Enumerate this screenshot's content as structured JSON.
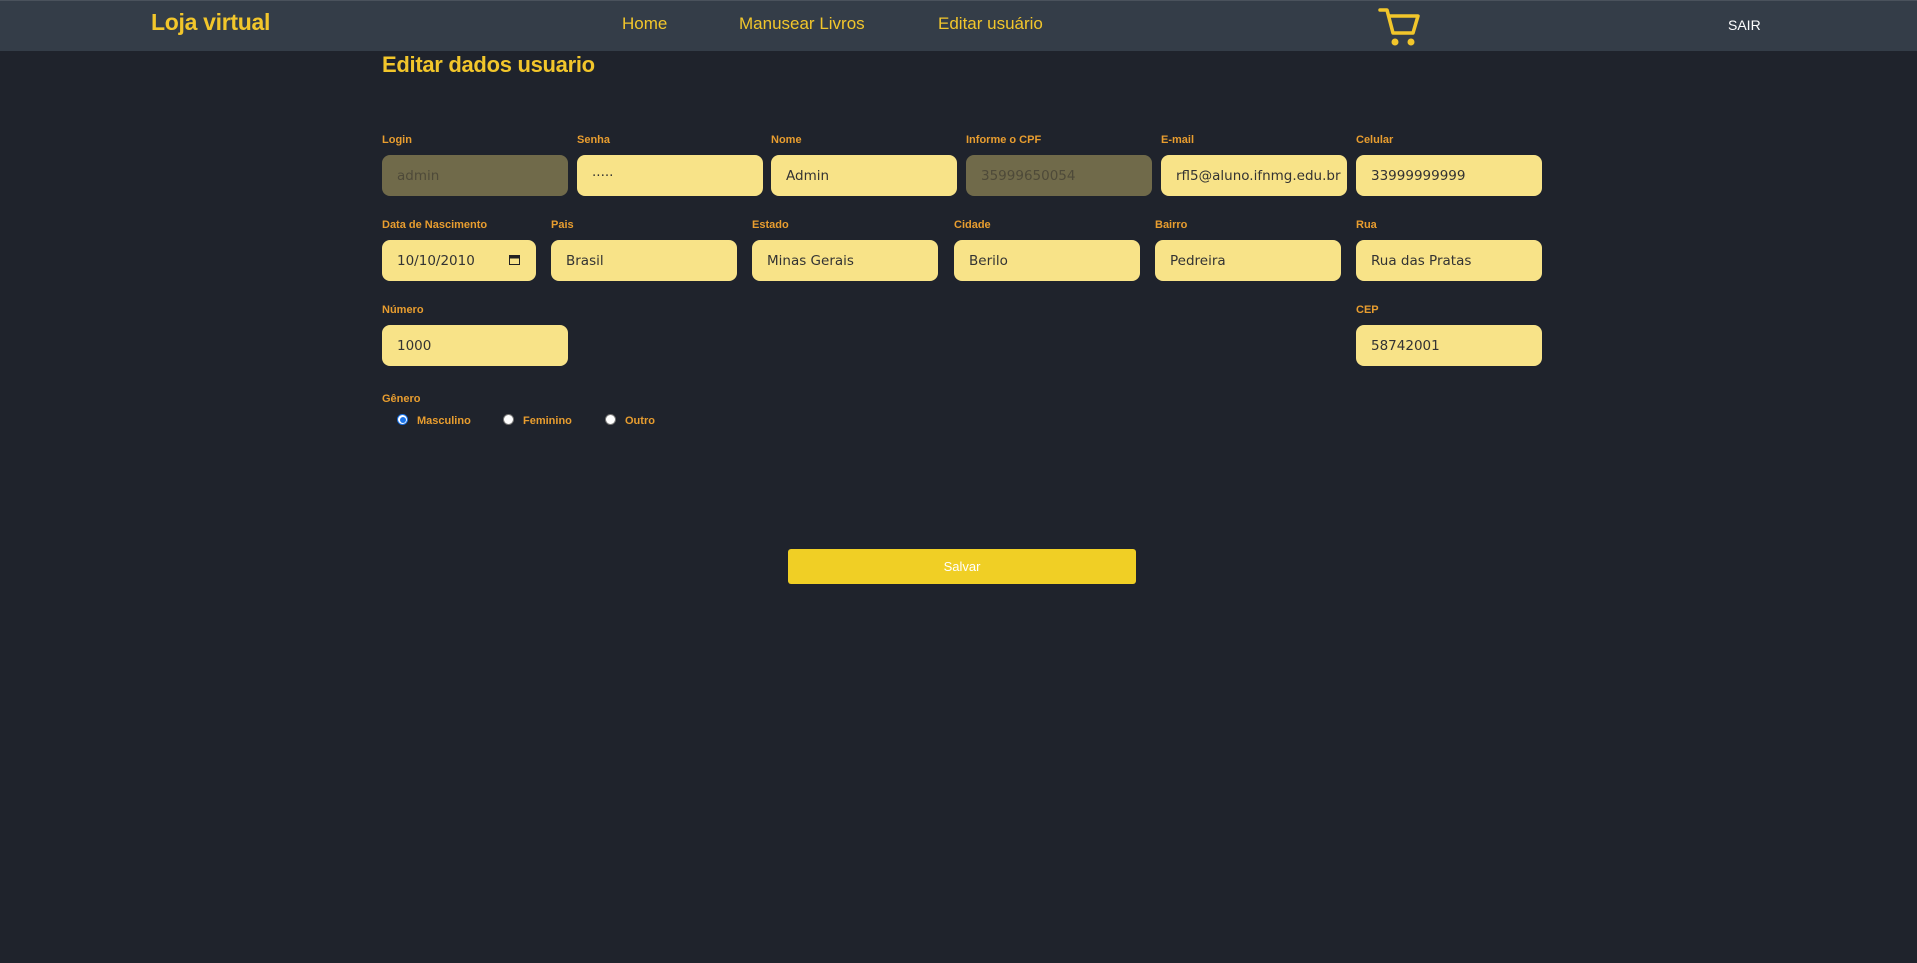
{
  "navbar": {
    "brand": "Loja virtual",
    "links": [
      "Home",
      "Manusear Livros",
      "Editar usuário"
    ],
    "cart_icon": "shopping-cart-icon",
    "logout": "SAIR"
  },
  "page_title": "Editar dados usuario",
  "form": {
    "login": {
      "label": "Login",
      "value": "admin",
      "disabled": true
    },
    "senha": {
      "label": "Senha",
      "value": "·····"
    },
    "nome": {
      "label": "Nome",
      "value": "Admin"
    },
    "cpf": {
      "label": "Informe o CPF",
      "value": "35999650054",
      "disabled": true
    },
    "email": {
      "label": "E-mail",
      "value": "rfl5@aluno.ifnmg.edu.br"
    },
    "celular": {
      "label": "Celular",
      "value": "33999999999"
    },
    "nascimento": {
      "label": "Data de Nascimento",
      "value": "10/10/2010",
      "icon": "calendar-icon"
    },
    "pais": {
      "label": "Pais",
      "value": "Brasil"
    },
    "estado": {
      "label": "Estado",
      "value": "Minas Gerais"
    },
    "cidade": {
      "label": "Cidade",
      "value": "Berilo"
    },
    "bairro": {
      "label": "Bairro",
      "value": "Pedreira"
    },
    "rua": {
      "label": "Rua",
      "value": "Rua das Pratas"
    },
    "numero": {
      "label": "Número",
      "value": "1000"
    },
    "cep": {
      "label": "CEP",
      "value": "58742001"
    },
    "genero": {
      "label": "Gênero",
      "options": [
        "Masculino",
        "Feminino",
        "Outro"
      ],
      "selected": "Masculino"
    }
  },
  "save_button": "Salvar",
  "colors": {
    "background": "#1f232c",
    "navbar": "#343d48",
    "accent": "#f2c62b",
    "label": "#e89d2f",
    "input": "#f8e388",
    "input_disabled": "#706a4a",
    "button": "#f0cf25"
  }
}
